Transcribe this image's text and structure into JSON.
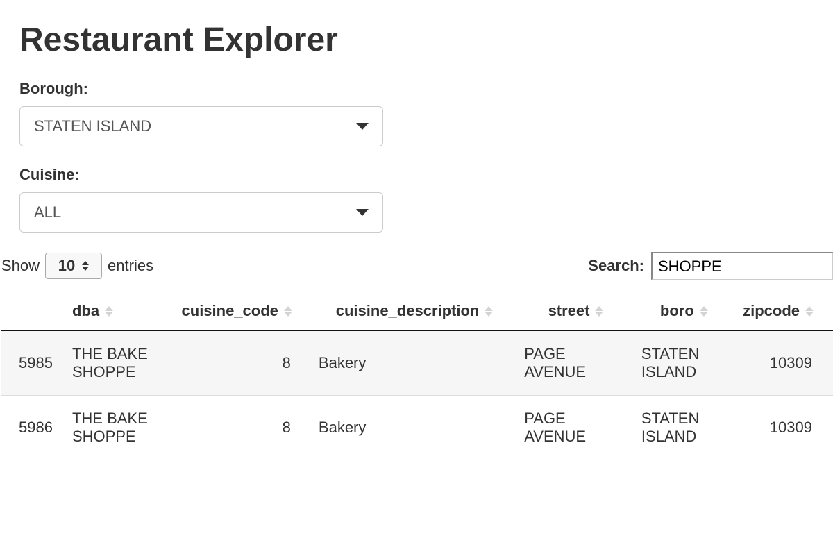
{
  "page": {
    "title": "Restaurant Explorer"
  },
  "filters": {
    "borough": {
      "label": "Borough:",
      "value": "STATEN ISLAND"
    },
    "cuisine": {
      "label": "Cuisine:",
      "value": "ALL"
    }
  },
  "table_controls": {
    "show_label": "Show",
    "entries_label": "entries",
    "page_size": "10",
    "search_label": "Search:",
    "search_value": "SHOPPE"
  },
  "table": {
    "headers": {
      "dba": "dba",
      "cuisine_code": "cuisine_code",
      "cuisine_description": "cuisine_description",
      "street": "street",
      "boro": "boro",
      "zipcode": "zipcode"
    },
    "rows": [
      {
        "idx": "5985",
        "dba": "THE BAKE SHOPPE",
        "cuisine_code": "8",
        "cuisine_description": "Bakery",
        "street": "PAGE AVENUE",
        "boro": "STATEN ISLAND",
        "zipcode": "10309"
      },
      {
        "idx": "5986",
        "dba": "THE BAKE SHOPPE",
        "cuisine_code": "8",
        "cuisine_description": "Bakery",
        "street": "PAGE AVENUE",
        "boro": "STATEN ISLAND",
        "zipcode": "10309"
      }
    ]
  }
}
